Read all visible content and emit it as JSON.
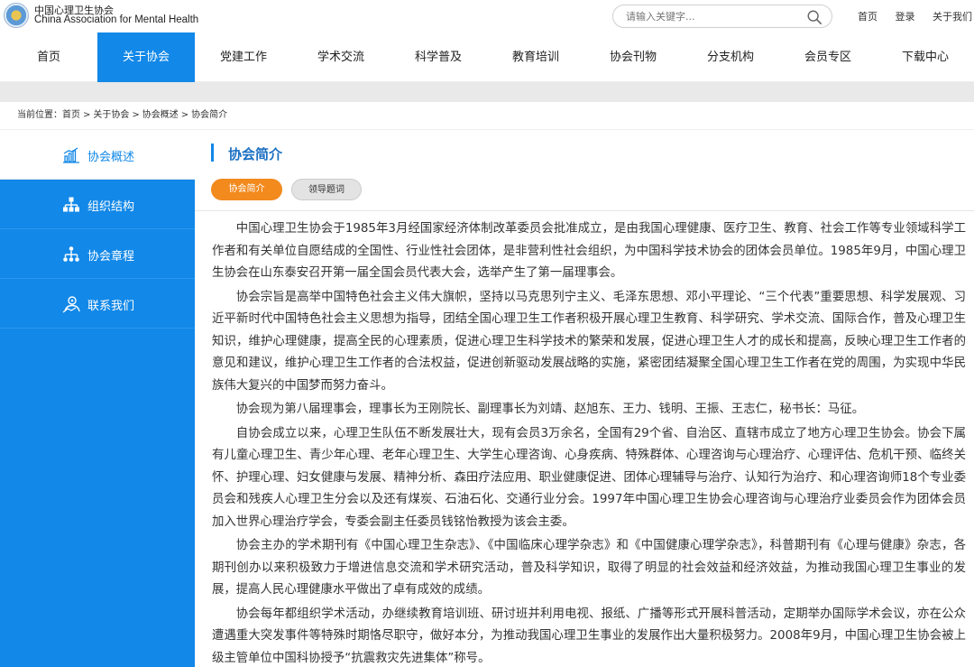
{
  "header": {
    "org_cn": "中国心理卫生协会",
    "org_en": "China Association for Mental Health",
    "search_placeholder": "请输入关键字...",
    "links": [
      "首页",
      "登录",
      "关于我们"
    ]
  },
  "nav": {
    "items": [
      "首页",
      "关于协会",
      "党建工作",
      "学术交流",
      "科学普及",
      "教育培训",
      "协会刊物",
      "分支机构",
      "会员专区",
      "下载中心"
    ],
    "active": "关于协会"
  },
  "breadcrumb": {
    "prefix": "当前位置：",
    "items": [
      "首页",
      "关于协会",
      "协会概述",
      "协会简介"
    ],
    "separator": ">"
  },
  "sidebar": {
    "items": [
      {
        "label": "协会概述",
        "icon": "chart-icon"
      },
      {
        "label": "组织结构",
        "icon": "org-chart-icon"
      },
      {
        "label": "协会章程",
        "icon": "hierarchy-icon"
      },
      {
        "label": "联系我们",
        "icon": "contact-icon"
      }
    ],
    "active": "协会概述"
  },
  "main": {
    "title": "协会简介",
    "tabs": [
      {
        "label": "协会简介",
        "active": true
      },
      {
        "label": "领导题词",
        "active": false
      }
    ],
    "paragraphs": [
      "中国心理卫生协会于1985年3月经国家经济体制改革委员会批准成立，是由我国心理健康、医疗卫生、教育、社会工作等专业领域科学工作者和有关单位自愿结成的全国性、行业性社会团体，是非营利性社会组织，为中国科学技术协会的团体会员单位。1985年9月，中国心理卫生协会在山东泰安召开第一届全国会员代表大会，选举产生了第一届理事会。",
      "协会宗旨是高举中国特色社会主义伟大旗帜，坚持以马克思列宁主义、毛泽东思想、邓小平理论、“三个代表”重要思想、科学发展观、习近平新时代中国特色社会主义思想为指导，团结全国心理卫生工作者积极开展心理卫生教育、科学研究、学术交流、国际合作，普及心理卫生知识，维护心理健康，提高全民的心理素质，促进心理卫生科学技术的繁荣和发展，促进心理卫生人才的成长和提高，反映心理卫生工作者的意见和建议，维护心理卫生工作者的合法权益，促进创新驱动发展战略的实施，紧密团结凝聚全国心理卫生工作者在党的周围，为实现中华民族伟大复兴的中国梦而努力奋斗。",
      "协会现为第八届理事会，理事长为王刚院长、副理事长为刘靖、赵旭东、王力、钱明、王振、王志仁，秘书长：马征。",
      "自协会成立以来，心理卫生队伍不断发展壮大，现有会员3万余名，全国有29个省、自治区、直辖市成立了地方心理卫生协会。协会下属有儿童心理卫生、青少年心理、老年心理卫生、大学生心理咨询、心身疾病、特殊群体、心理咨询与心理治疗、心理评估、危机干预、临终关怀、护理心理、妇女健康与发展、精神分析、森田疗法应用、职业健康促进、团体心理辅导与治疗、认知行为治疗、和心理咨询师18个专业委员会和残疾人心理卫生分会以及还有煤炭、石油石化、交通行业分会。1997年中国心理卫生协会心理咨询与心理治疗业委员会作为团体会员加入世界心理治疗学会，专委会副主任委员钱铭怡教授为该会主委。",
      "协会主办的学术期刊有《中国心理卫生杂志》、《中国临床心理学杂志》和《中国健康心理学杂志》，科普期刊有《心理与健康》杂志，各期刊创办以来积极致力于增进信息交流和学术研究活动，普及科学知识，取得了明显的社会效益和经济效益，为推动我国心理卫生事业的发展，提高人民心理健康水平做出了卓有成效的成绩。",
      "协会每年都组织学术活动，办继续教育培训班、研讨班并利用电视、报纸、广播等形式开展科普活动，定期举办国际学术会议，亦在公众遭遇重大突发事件等特殊时期恪尽职守，做好本分，为推动我国心理卫生事业的发展作出大量积极努力。2008年9月，中国心理卫生协会被上级主管单位中国科协授予“抗震救灾先进集体”称号。"
    ]
  },
  "colors": {
    "primary_blue": "#1288e8",
    "tab_orange": "#f28a1e",
    "title_blue": "#1a6fc2"
  }
}
